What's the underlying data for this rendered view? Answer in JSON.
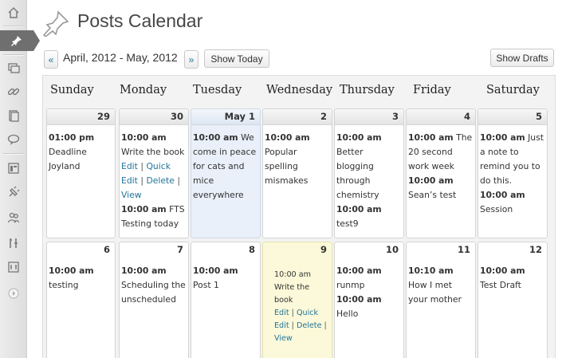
{
  "page": {
    "title": "Posts Calendar"
  },
  "sidebar": {
    "items": [
      {
        "icon": "home-icon"
      },
      {
        "icon": "pushpin-icon",
        "active": true
      },
      {
        "icon": "media-icon"
      },
      {
        "icon": "links-icon"
      },
      {
        "icon": "pages-icon"
      },
      {
        "icon": "comments-icon"
      },
      {
        "icon": "appearance-icon"
      },
      {
        "icon": "plugins-icon"
      },
      {
        "icon": "users-icon"
      },
      {
        "icon": "tools-icon"
      },
      {
        "icon": "settings-icon"
      },
      {
        "icon": "collapse-icon"
      }
    ]
  },
  "toolbar": {
    "prev_label": "«",
    "next_label": "»",
    "range": "April, 2012 - May, 2012",
    "show_today_label": "Show Today",
    "show_drafts_label": "Show Drafts"
  },
  "calendar": {
    "weekdays": [
      "Sunday",
      "Monday",
      "Tuesday",
      "Wednesday",
      "Thursday",
      "Friday",
      "Saturday"
    ],
    "week1": [
      {
        "num": "29",
        "events": [
          {
            "time": "01:00 pm",
            "title": "Deadline Joyland"
          }
        ]
      },
      {
        "num": "30",
        "events": [
          {
            "time": "10:00 am",
            "title": "Write the book",
            "actions": [
              "Edit",
              "Quick Edit",
              "Delete",
              "View"
            ]
          },
          {
            "time": "10:00 am",
            "title": "FTS Testing today"
          }
        ]
      },
      {
        "num": "May 1",
        "events": [
          {
            "time": "10:00 am",
            "title": "We come in peace for cats and mice everywhere"
          }
        ]
      },
      {
        "num": "2",
        "events": [
          {
            "time": "10:00 am",
            "title": "Popular spelling mismakes"
          }
        ]
      },
      {
        "num": "3",
        "events": [
          {
            "time": "10:00 am",
            "title": "Better blogging through chemistry"
          },
          {
            "time": "10:00 am",
            "title": "test9"
          }
        ]
      },
      {
        "num": "4",
        "events": [
          {
            "time": "10:00 am",
            "title": "The 20 second work week"
          },
          {
            "time": "10:00 am",
            "title": "Sean’s test"
          }
        ]
      },
      {
        "num": "5",
        "events": [
          {
            "time": "10:00 am",
            "title": "Just a note to remind you to do this."
          },
          {
            "time": "10:00 am",
            "title": "Session"
          }
        ]
      }
    ],
    "week2": [
      {
        "num": "6",
        "events": [
          {
            "time": "10:00 am",
            "title": "testing"
          }
        ]
      },
      {
        "num": "7",
        "events": [
          {
            "time": "10:00 am",
            "title": "Scheduling the unscheduled"
          }
        ]
      },
      {
        "num": "8",
        "events": [
          {
            "time": "10:00 am",
            "title": "Post 1"
          }
        ]
      },
      {
        "num": "9",
        "events": [
          {
            "time": "10:00 am",
            "title": "Write the book",
            "actions": [
              "Edit",
              "Quick Edit",
              "Delete",
              "View"
            ]
          }
        ]
      },
      {
        "num": "10",
        "events": [
          {
            "time": "10:00 am",
            "title": "runmp"
          },
          {
            "time": "10:00 am",
            "title": "Hello"
          }
        ]
      },
      {
        "num": "11",
        "events": [
          {
            "time": "10:10 am",
            "title": "How I met your mother"
          }
        ]
      },
      {
        "num": "12",
        "events": [
          {
            "time": "10:00 am",
            "title": "Test Draft"
          }
        ]
      }
    ]
  }
}
